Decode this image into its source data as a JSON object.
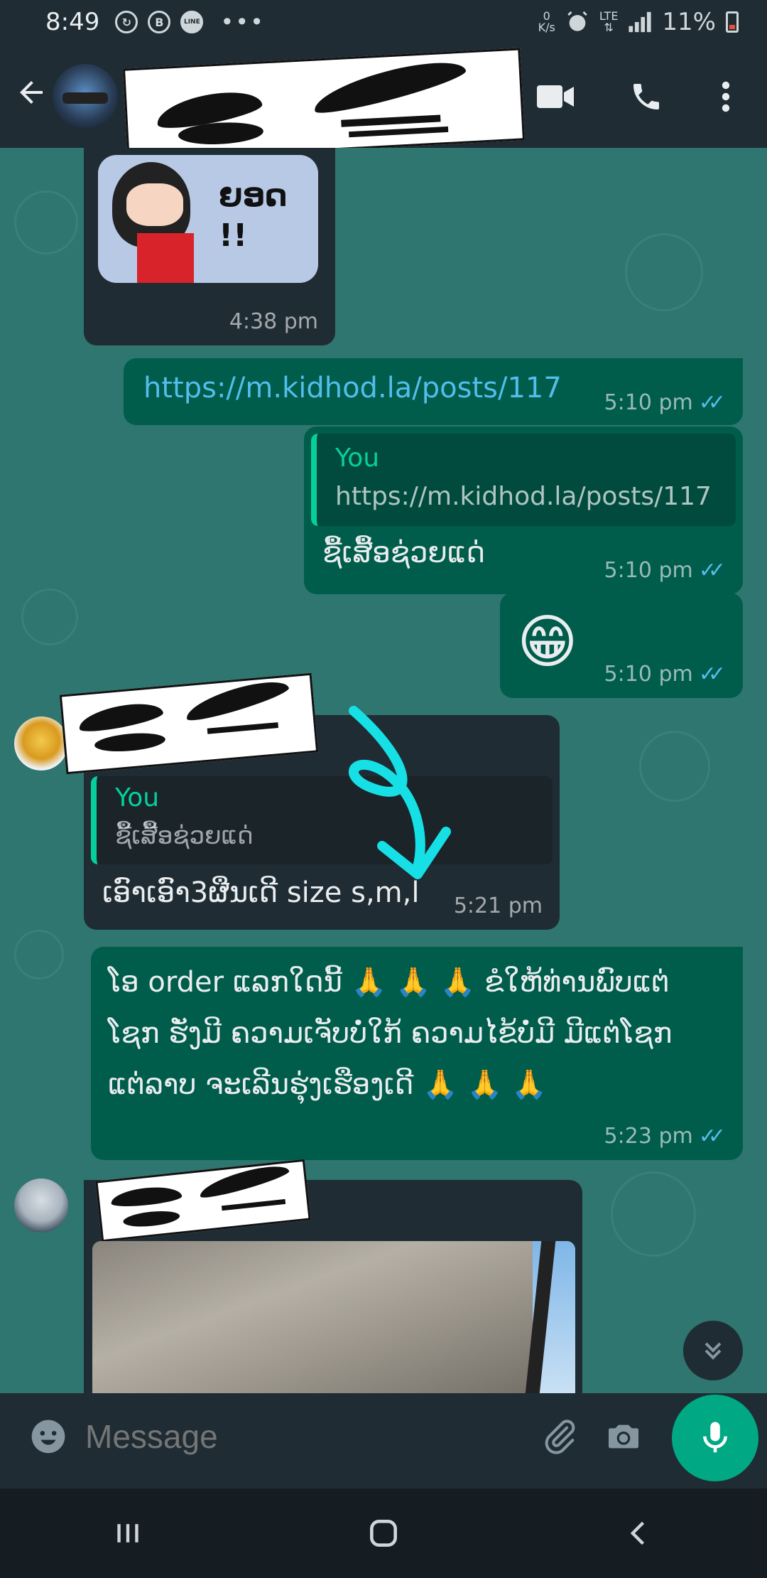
{
  "status_bar": {
    "time": "8:49",
    "net_speed_value": "0",
    "net_speed_unit": "K/s",
    "lte_label": "LTE",
    "battery_percent": "11%",
    "notification_icons": [
      "rotation-icon",
      "b-icon",
      "line-icon"
    ]
  },
  "header": {
    "contact_name_hidden": true,
    "icons": [
      "back-arrow-icon",
      "video-call-icon",
      "phone-call-icon",
      "more-vert-icon"
    ]
  },
  "messages": [
    {
      "id": "m1",
      "direction": "in",
      "type": "sticker",
      "sticker_text": "ຍອດ !!",
      "time": "4:38 pm"
    },
    {
      "id": "m2",
      "direction": "out",
      "type": "link",
      "text": "https://m.kidhod.la/posts/117",
      "time": "5:10 pm"
    },
    {
      "id": "m3",
      "direction": "out",
      "type": "reply",
      "quote_author": "You",
      "quote_text": "https://m.kidhod.la/posts/117",
      "text": "ຊື້ເສື້ອຊ່ວຍແດ່",
      "time": "5:10 pm"
    },
    {
      "id": "m4",
      "direction": "out",
      "type": "emoji",
      "text": "😁",
      "time": "5:10 pm"
    },
    {
      "id": "m5",
      "direction": "in",
      "type": "reply",
      "quote_author": "You",
      "quote_text": "ຊື້ເສື້ອຊ່ວຍແດ່",
      "text": "ເອົາເອົາ3ຜືນເດີ size s,m,l",
      "time": "5:21 pm"
    },
    {
      "id": "m6",
      "direction": "out",
      "type": "text",
      "lines": [
        "ໂອ order ແລກໃດນີ້ 🙏 🙏 🙏 ຂໍໃຫ້ທ່ານພົບແຕ່",
        "ໂຊກ ຮັ່ງມີ ຄວາມເຈັບບໍ່ໃກ້ ຄວາມໄຂ້ບໍ່ມີ ມີແຕ່ໂຊກ",
        "ແຕ່ລາບ ຈະເລີນຮຸ່ງເຮືອງເດີ 🙏 🙏 🙏"
      ],
      "time": "5:23 pm"
    },
    {
      "id": "m7",
      "direction": "in",
      "type": "image",
      "time": ""
    }
  ],
  "input": {
    "placeholder": "Message",
    "icons": [
      "emoji-icon",
      "attach-icon",
      "camera-icon",
      "mic-icon"
    ]
  },
  "nav_bar": {
    "icons": [
      "recent-apps-icon",
      "home-icon",
      "back-icon"
    ]
  },
  "colors": {
    "chat_bg": "#2e766f",
    "bubble_in": "#202c33",
    "bubble_out": "#005c4b",
    "accent": "#00a884",
    "link": "#53bdeb",
    "quote_bar": "#06cf9c"
  }
}
